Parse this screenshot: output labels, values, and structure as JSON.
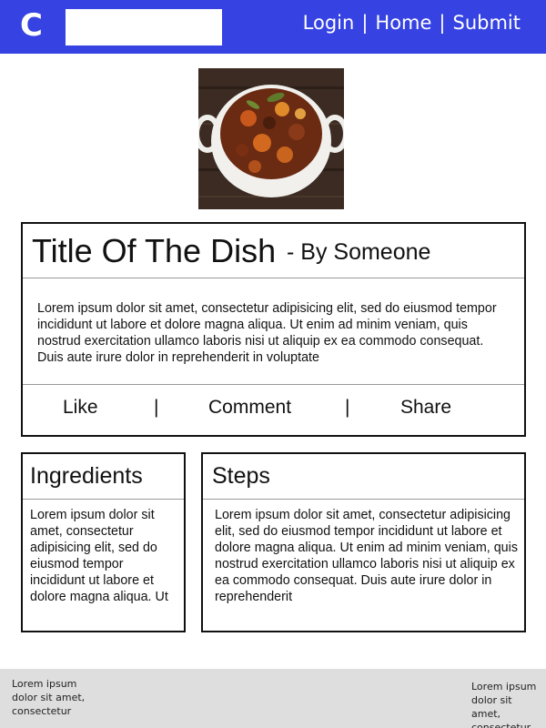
{
  "header": {
    "logo": "C",
    "search": {
      "value": "",
      "placeholder": ""
    },
    "nav": {
      "login": "Login",
      "home": "Home",
      "submit": "Submit",
      "separator": "|"
    }
  },
  "colors": {
    "header_bg": "#3642e2",
    "footer_bg": "#dedede",
    "border": "#111111"
  },
  "dish": {
    "title": "Title Of The Dish",
    "author": "- By Someone",
    "description": "Lorem ipsum dolor sit amet, consectetur adipisicing elit, sed do eiusmod tempor incididunt ut labore et dolore magna aliqua. Ut enim ad minim veniam, quis nostrud exercitation ullamco laboris nisi ut aliquip ex ea commodo consequat. Duis aute irure dolor in reprehenderit in voluptate",
    "actions": {
      "like": "Like",
      "comment": "Comment",
      "share": "Share",
      "separator": "|"
    }
  },
  "ingredients": {
    "title": "Ingredients",
    "body": "Lorem ipsum dolor sit amet, consectetur adipisicing elit, sed do eiusmod tempor incididunt ut labore et dolore magna aliqua. Ut"
  },
  "steps": {
    "title": "Steps",
    "body": "Lorem ipsum dolor sit amet, consectetur adipisicing elit, sed do eiusmod tempor incididunt ut labore et dolore magna aliqua. Ut enim ad minim veniam, quis nostrud exercitation ullamco laboris nisi ut aliquip ex ea commodo consequat. Duis aute irure dolor in reprehenderit"
  },
  "footer": {
    "left": "Lorem ipsum dolor sit amet, consectetur",
    "right": "Lorem ipsum dolor sit amet, consectetur"
  }
}
